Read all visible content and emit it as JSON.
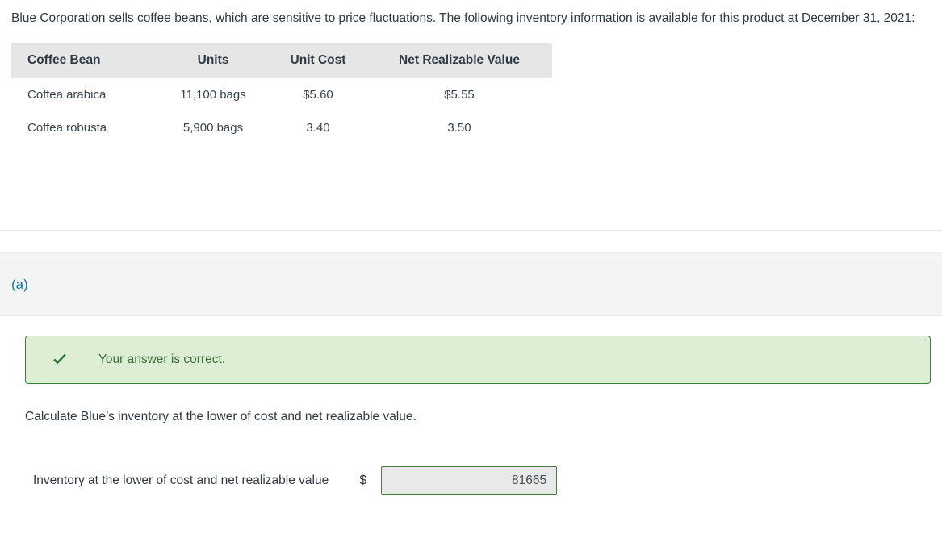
{
  "prompt": {
    "text": "Blue Corporation sells coffee beans, which are sensitive to price fluctuations. The following inventory information is available for this product at December 31, 2021:"
  },
  "inventory_table": {
    "headers": [
      "Coffee Bean",
      "Units",
      "Unit Cost",
      "Net Realizable Value"
    ],
    "rows": [
      {
        "bean": "Coffea arabica",
        "units": "11,100 bags",
        "unit_cost": "$5.60",
        "nrv": "$5.55"
      },
      {
        "bean": "Coffea robusta",
        "units": "5,900 bags",
        "unit_cost": "3.40",
        "nrv": "3.50"
      }
    ]
  },
  "part": {
    "label": "(a)",
    "accent_color": "#18749c"
  },
  "feedback": {
    "icon": "check-icon",
    "message": "Your answer is correct.",
    "background_color": "#ddeed4",
    "border_color": "#3f7a3f",
    "text_color": "#3c6b3c"
  },
  "question": {
    "text": "Calculate Blue’s inventory at the lower of cost and net realizable value."
  },
  "answer": {
    "label": "Inventory at the lower of cost and net realizable value",
    "currency_symbol": "$",
    "value": "81665",
    "placeholder": "",
    "input_border_color": "#4b7a4b",
    "input_background_color": "#e9e9e9"
  }
}
